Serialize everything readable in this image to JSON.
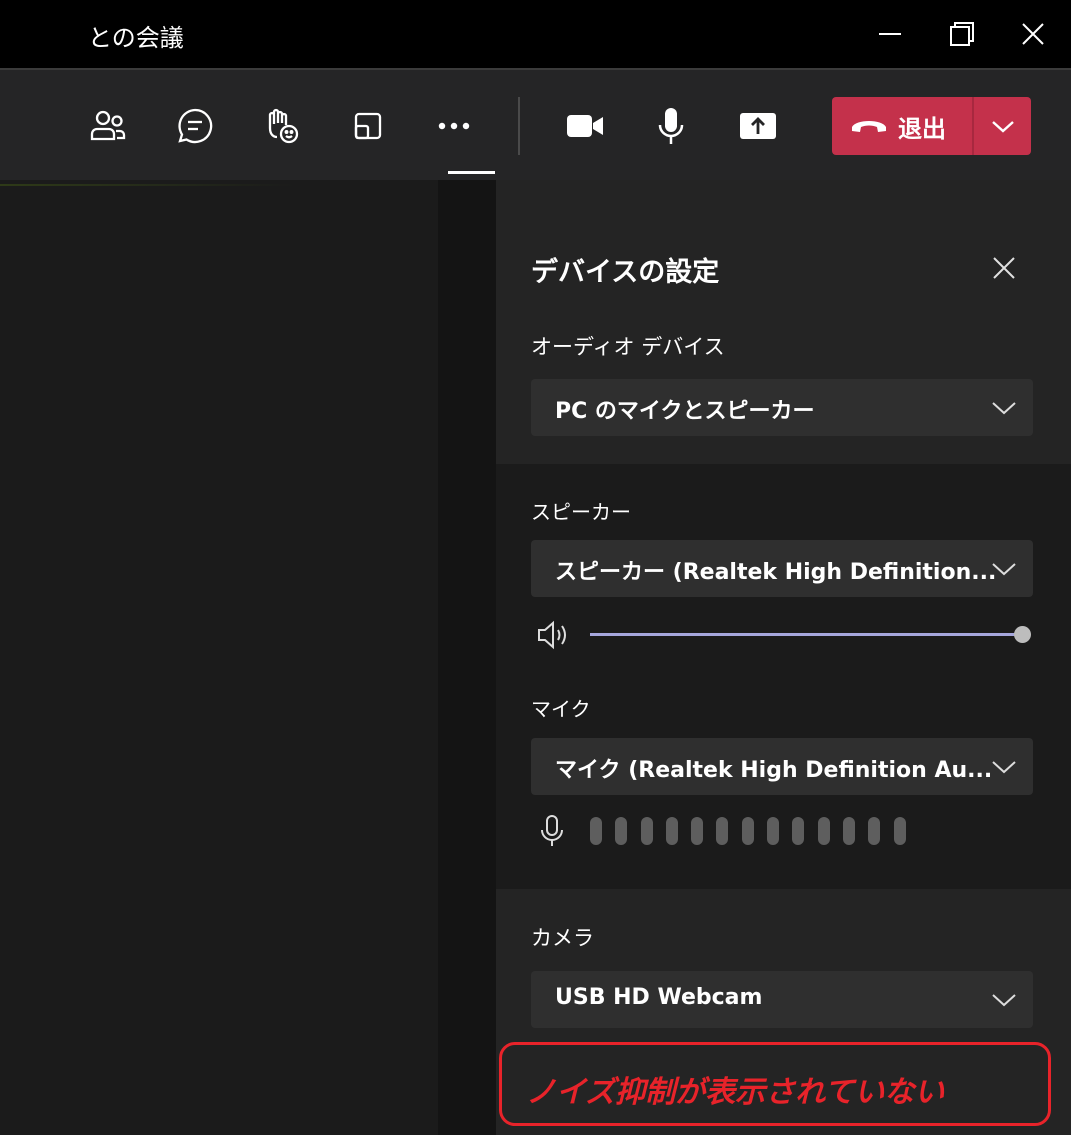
{
  "window": {
    "title": "との会議"
  },
  "toolbar": {
    "leave_label": "退出"
  },
  "panel": {
    "title": "デバイスの設定",
    "audio_device_label": "オーディオ デバイス",
    "audio_device_value": "PC のマイクとスピーカー",
    "speaker_label": "スピーカー",
    "speaker_value": "スピーカー (Realtek High Definition...",
    "speaker_volume": 1.0,
    "mic_label": "マイク",
    "mic_value": "マイク (Realtek High Definition Au...",
    "mic_level_bars": 13,
    "camera_label": "カメラ",
    "camera_value": "USB HD Webcam"
  },
  "annotation": {
    "text": "ノイズ抑制が表示されていない"
  },
  "colors": {
    "leave": "#c4314b",
    "slider": "#a6a7dc",
    "annotation": "#e8232a"
  }
}
